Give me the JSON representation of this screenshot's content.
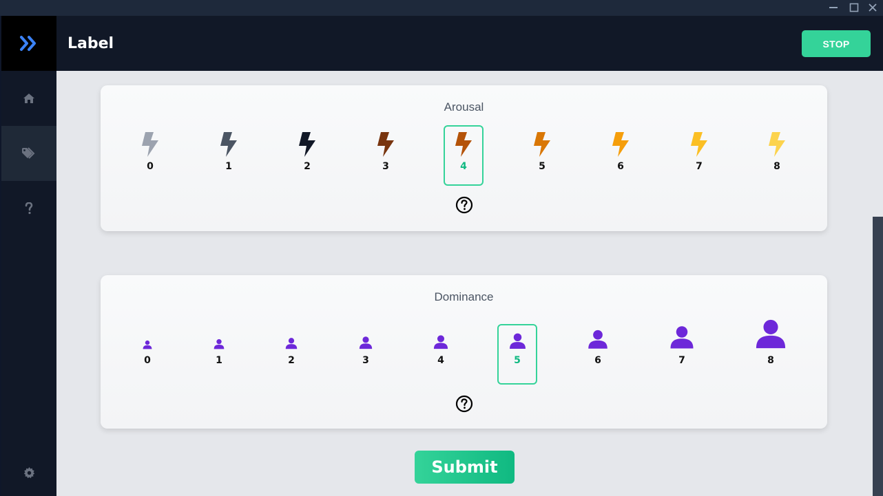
{
  "window": {
    "controls": [
      "minimize",
      "maximize",
      "close"
    ]
  },
  "sidebar": {
    "logo_icon": "double-chevron-right-icon",
    "items": [
      {
        "id": "home",
        "icon": "home-icon",
        "active": false
      },
      {
        "id": "label",
        "icon": "tags-icon",
        "active": true
      },
      {
        "id": "help",
        "icon": "question-icon",
        "active": false
      },
      {
        "id": "settings",
        "icon": "gear-icon",
        "active": false
      }
    ]
  },
  "header": {
    "title": "Label",
    "stop_label": "STOP"
  },
  "arousal": {
    "title": "Arousal",
    "selected": 4,
    "options": [
      {
        "label": "0",
        "color": "#9ca3af"
      },
      {
        "label": "1",
        "color": "#4b5563"
      },
      {
        "label": "2",
        "color": "#111827"
      },
      {
        "label": "3",
        "color": "#78350f"
      },
      {
        "label": "4",
        "color": "#b45309"
      },
      {
        "label": "5",
        "color": "#d97706"
      },
      {
        "label": "6",
        "color": "#f59e0b"
      },
      {
        "label": "7",
        "color": "#fbbf24"
      },
      {
        "label": "8",
        "color": "#fcd34d"
      }
    ]
  },
  "dominance": {
    "title": "Dominance",
    "selected": 5,
    "color": "#6d28d9",
    "options": [
      {
        "label": "0"
      },
      {
        "label": "1"
      },
      {
        "label": "2"
      },
      {
        "label": "3"
      },
      {
        "label": "4"
      },
      {
        "label": "5"
      },
      {
        "label": "6"
      },
      {
        "label": "7"
      },
      {
        "label": "8"
      }
    ]
  },
  "submit_label": "Submit",
  "colors": {
    "accent": "#34d399",
    "sidebar": "#111827",
    "content_bg": "#e5e7eb"
  }
}
